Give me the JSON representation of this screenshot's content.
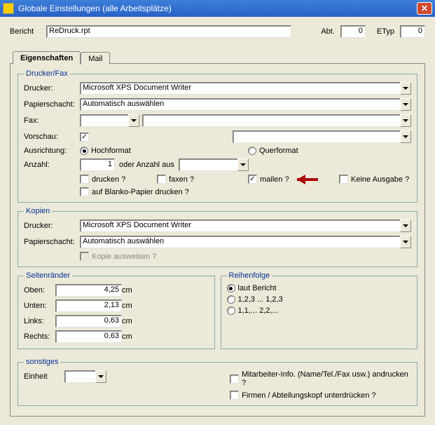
{
  "window": {
    "title": "Globale Einstellungen (alle Arbeitsplätze)"
  },
  "header": {
    "bericht_label": "Bericht",
    "bericht_value": "ReDruck.rpt",
    "abt_label": "Abt.",
    "abt_value": "0",
    "etyp_label": "ETyp",
    "etyp_value": "0"
  },
  "tabs": {
    "eigenschaften": "Eigenschaften",
    "mail": "Mail"
  },
  "druckerfax": {
    "legend": "Drucker/Fax",
    "drucker_label": "Drucker:",
    "drucker_value": "Microsoft XPS Document Writer",
    "papier_label": "Papierschacht:",
    "papier_value": "Automatisch auswählen",
    "fax_label": "Fax:",
    "vorschau_label": "Vorschau:",
    "ausrichtung_label": "Ausrichtung:",
    "hoch": "Hochformat",
    "quer": "Querformat",
    "anzahl_label": "Anzahl:",
    "anzahl_value": "1",
    "oderanzahl": "oder Anzahl aus",
    "drucken": "drucken ?",
    "faxen": "faxen ?",
    "mailen": "mailen ?",
    "keineausgabe": "Keine Ausgabe ?",
    "blanko": "auf Blanko-Papier drucken ?"
  },
  "kopien": {
    "legend": "Kopien",
    "drucker_label": "Drucker:",
    "drucker_value": "Microsoft XPS Document Writer",
    "papier_label": "Papierschacht:",
    "papier_value": "Automatisch auswählen",
    "kopie": "Kopie ausweisen ?"
  },
  "seiten": {
    "legend": "Seitenränder",
    "oben_label": "Oben:",
    "oben_value": "4,25",
    "unten_label": "Unten:",
    "unten_value": "2,13",
    "links_label": "Links:",
    "links_value": "0,63",
    "rechts_label": "Rechts:",
    "rechts_value": "0,63",
    "cm": "cm"
  },
  "reihen": {
    "legend": "Reihenfolge",
    "r1": "laut Bericht",
    "r2": "1,2,3 ... 1,2,3",
    "r3": "1,1,... 2,2,..."
  },
  "sonstiges": {
    "legend": "sonstiges",
    "einheit_label": "Einheit",
    "mitarbeiter": "Mitarbeiter-Info. (Name/Tel./Fax usw.) andrucken ?",
    "firmen": "Firmen / Abteilungskopf unterdrücken ?"
  }
}
